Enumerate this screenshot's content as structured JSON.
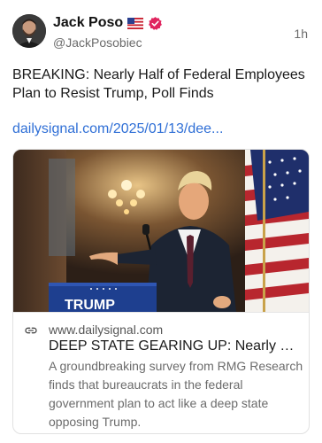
{
  "author": {
    "display_name": "Jack Poso",
    "handle": "@JackPosobiec",
    "flag_icon": "us-flag-icon",
    "verified_icon": "verified-badge-icon",
    "avatar_icon": "avatar"
  },
  "post": {
    "time": "1h",
    "text": "BREAKING: Nearly Half of Federal Employees Plan to Resist Trump, Poll Finds",
    "link": "dailysignal.com/2025/01/13/dee..."
  },
  "card": {
    "icon": "link-icon",
    "domain": "www.dailysignal.com",
    "title": "DEEP STATE GEARING UP: Nearly Half...",
    "description": "A groundbreaking survey from RMG Research finds that bureaucrats in the federal government plan to act like a deep state opposing Trump.",
    "podium_text": "TRUMP"
  },
  "colors": {
    "link": "#2f6fd6",
    "verified": "#e0245e",
    "muted": "#6b6b6b"
  }
}
